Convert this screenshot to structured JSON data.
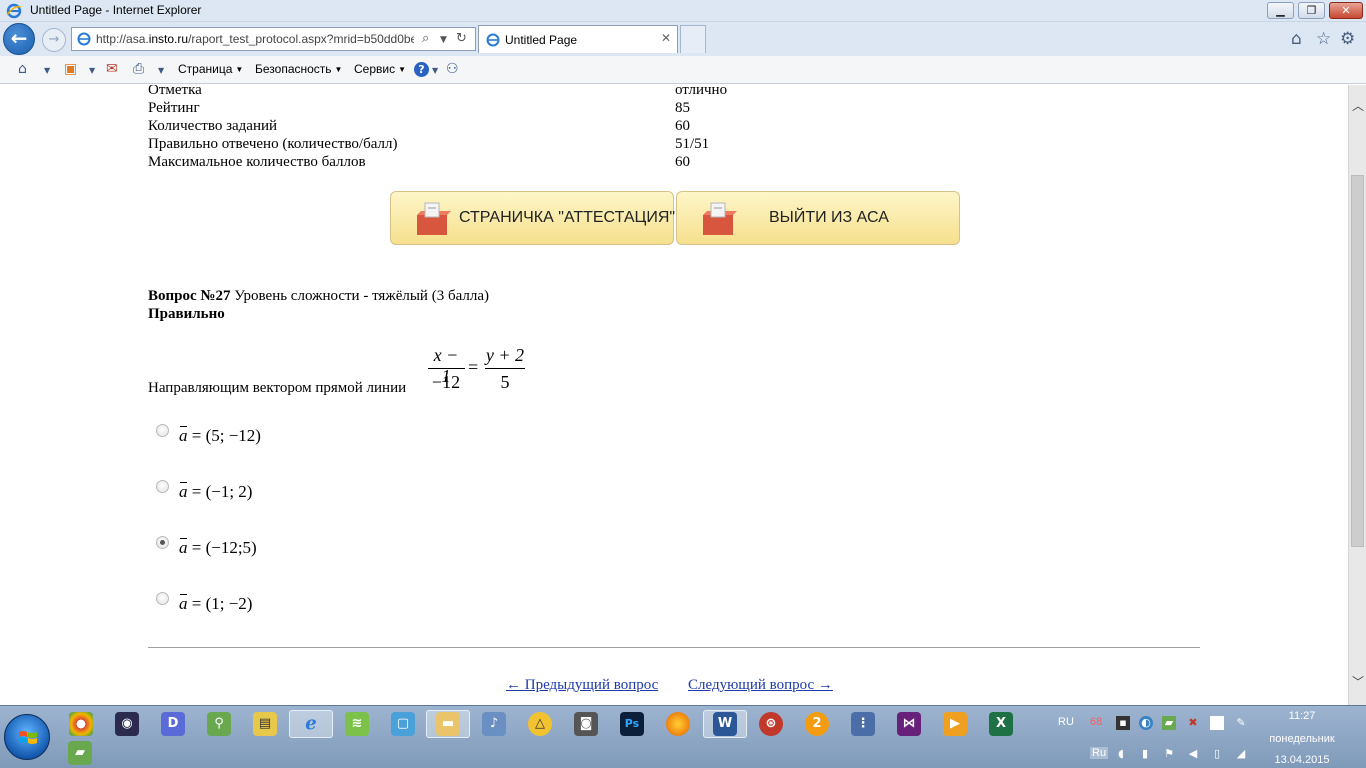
{
  "window": {
    "title": "Untitled Page - Internet Explorer",
    "min_label": "▁",
    "max_label": "❐",
    "close_label": "✕"
  },
  "nav": {
    "back_label": "←",
    "forward_label": "→",
    "url_prefix": "http://asa.",
    "url_domain": "insto.ru",
    "url_rest": "/raport_test_protocol.aspx?mrid=b50dd0be",
    "tab_title": "Untitled Page",
    "tab_close": "✕",
    "home_label": "⌂",
    "fav_label": "☆",
    "tools_label": "⚙"
  },
  "cmdbar": {
    "home": "⌂",
    "feeds": "▣",
    "mail": "✉",
    "print": "⎙",
    "page": "Страница",
    "safety": "Безопасность",
    "tools": "Сервис",
    "help": "?"
  },
  "summary": [
    {
      "label": "Отметка",
      "value": "отлично"
    },
    {
      "label": "Рейтинг",
      "value": "85"
    },
    {
      "label": "Количество заданий",
      "value": "60"
    },
    {
      "label": "Правильно отвечено (количество/балл)",
      "value": "51/51"
    },
    {
      "label": "Максимальное количество баллов",
      "value": "60"
    }
  ],
  "buttons": {
    "attestation": "СТРАНИЧКА \"АТТЕСТАЦИЯ\"",
    "exit": "ВЫЙТИ ИЗ АСА"
  },
  "question": {
    "number": "Вопрос №27",
    "difficulty": " Уровень сложности - тяжёлый (3 балла)",
    "status": "Правильно",
    "text": "Направляющим вектором прямой линии",
    "eq_num1": "x − 1",
    "eq_den1": "−12",
    "eq_sign": "=",
    "eq_num2": "y + 2",
    "eq_den2": "5"
  },
  "options": [
    {
      "vec": "a",
      "value": " = (5; −12)",
      "checked": false
    },
    {
      "vec": "a",
      "value": " = (−1; 2)",
      "checked": false
    },
    {
      "vec": "a",
      "value": " = (−12;5)",
      "checked": true
    },
    {
      "vec": "a",
      "value": " = (1; −2)",
      "checked": false
    }
  ],
  "links": {
    "prev": "← Предыдущий вопрос",
    "next": "Следующий вопрос →"
  },
  "taskbar": {
    "lang": "RU",
    "lang2": "Ru",
    "badge": "68",
    "time": "11:27",
    "day": "понедельник",
    "date": "13.04.2015"
  }
}
